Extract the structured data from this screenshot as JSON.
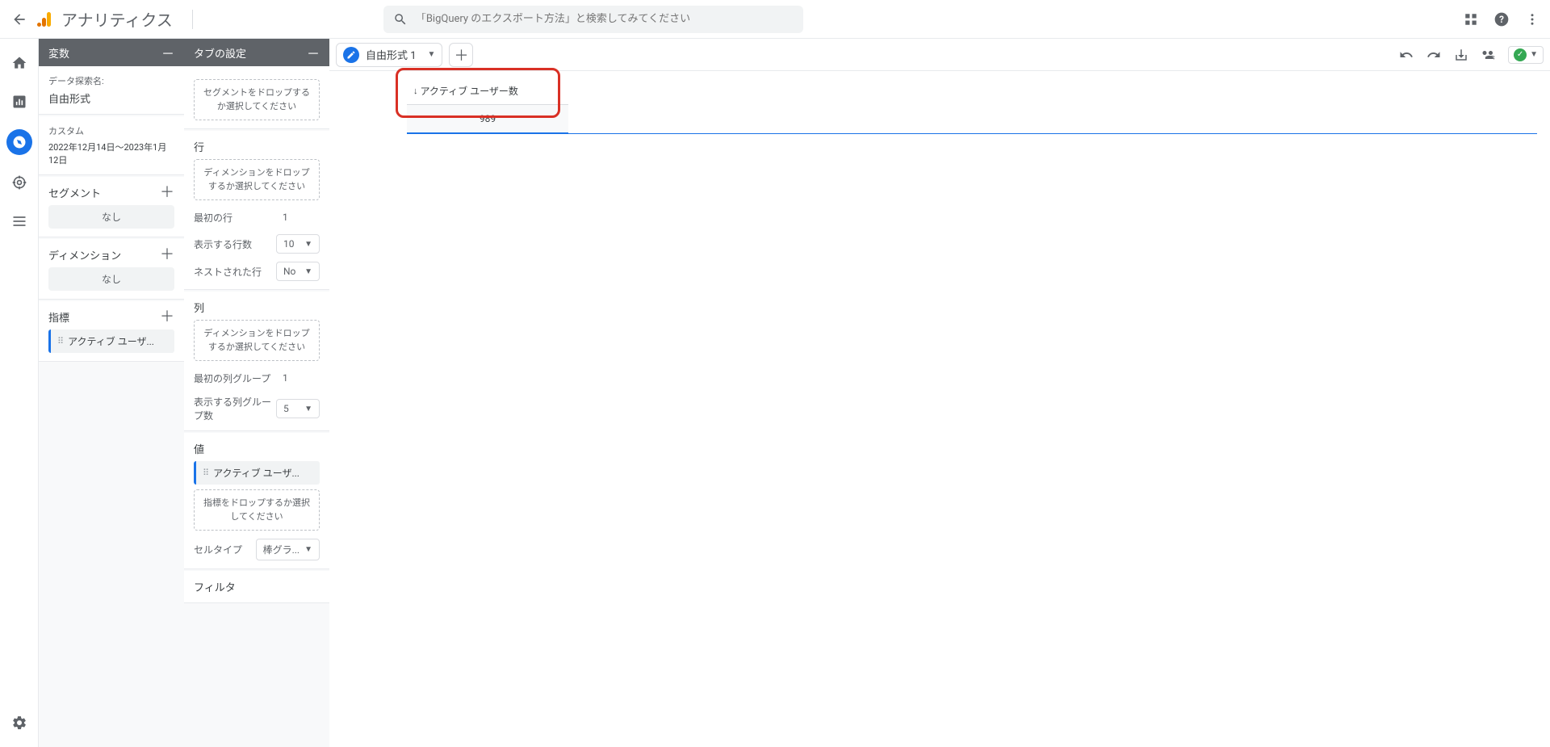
{
  "header": {
    "app_title": "アナリティクス",
    "search_placeholder": "「BigQuery のエクスポート方法」と検索してみてください"
  },
  "panel_vars": {
    "title": "変数",
    "exploration_label": "データ探索名:",
    "exploration_name": "自由形式",
    "custom_label": "カスタム",
    "date_range": "2022年12月14日～2023年1月12日",
    "segments_label": "セグメント",
    "none_text": "なし",
    "dimensions_label": "ディメンション",
    "metrics_label": "指標",
    "metric_chip": "アクティブ ユーザ..."
  },
  "panel_tabs": {
    "title": "タブの設定",
    "segment_drop": "セグメントをドロップするか選択してください",
    "rows_label": "行",
    "dim_drop": "ディメンションをドロップするか選択してください",
    "first_row_label": "最初の行",
    "first_row_value": "1",
    "show_rows_label": "表示する行数",
    "show_rows_value": "10",
    "nested_label": "ネストされた行",
    "nested_value": "No",
    "cols_label": "列",
    "first_col_group_label": "最初の列グループ",
    "first_col_group_value": "1",
    "show_col_groups_label": "表示する列グループ数",
    "show_col_groups_value": "5",
    "values_label": "値",
    "value_chip": "アクティブ ユーザ...",
    "metric_drop": "指標をドロップするか選択してください",
    "cell_type_label": "セルタイプ",
    "cell_type_value": "棒グラ...",
    "filter_label": "フィルタ"
  },
  "canvas": {
    "tab_name": "自由形式 1",
    "table_header": "アクティブ ユーザー数",
    "table_value": "989"
  }
}
